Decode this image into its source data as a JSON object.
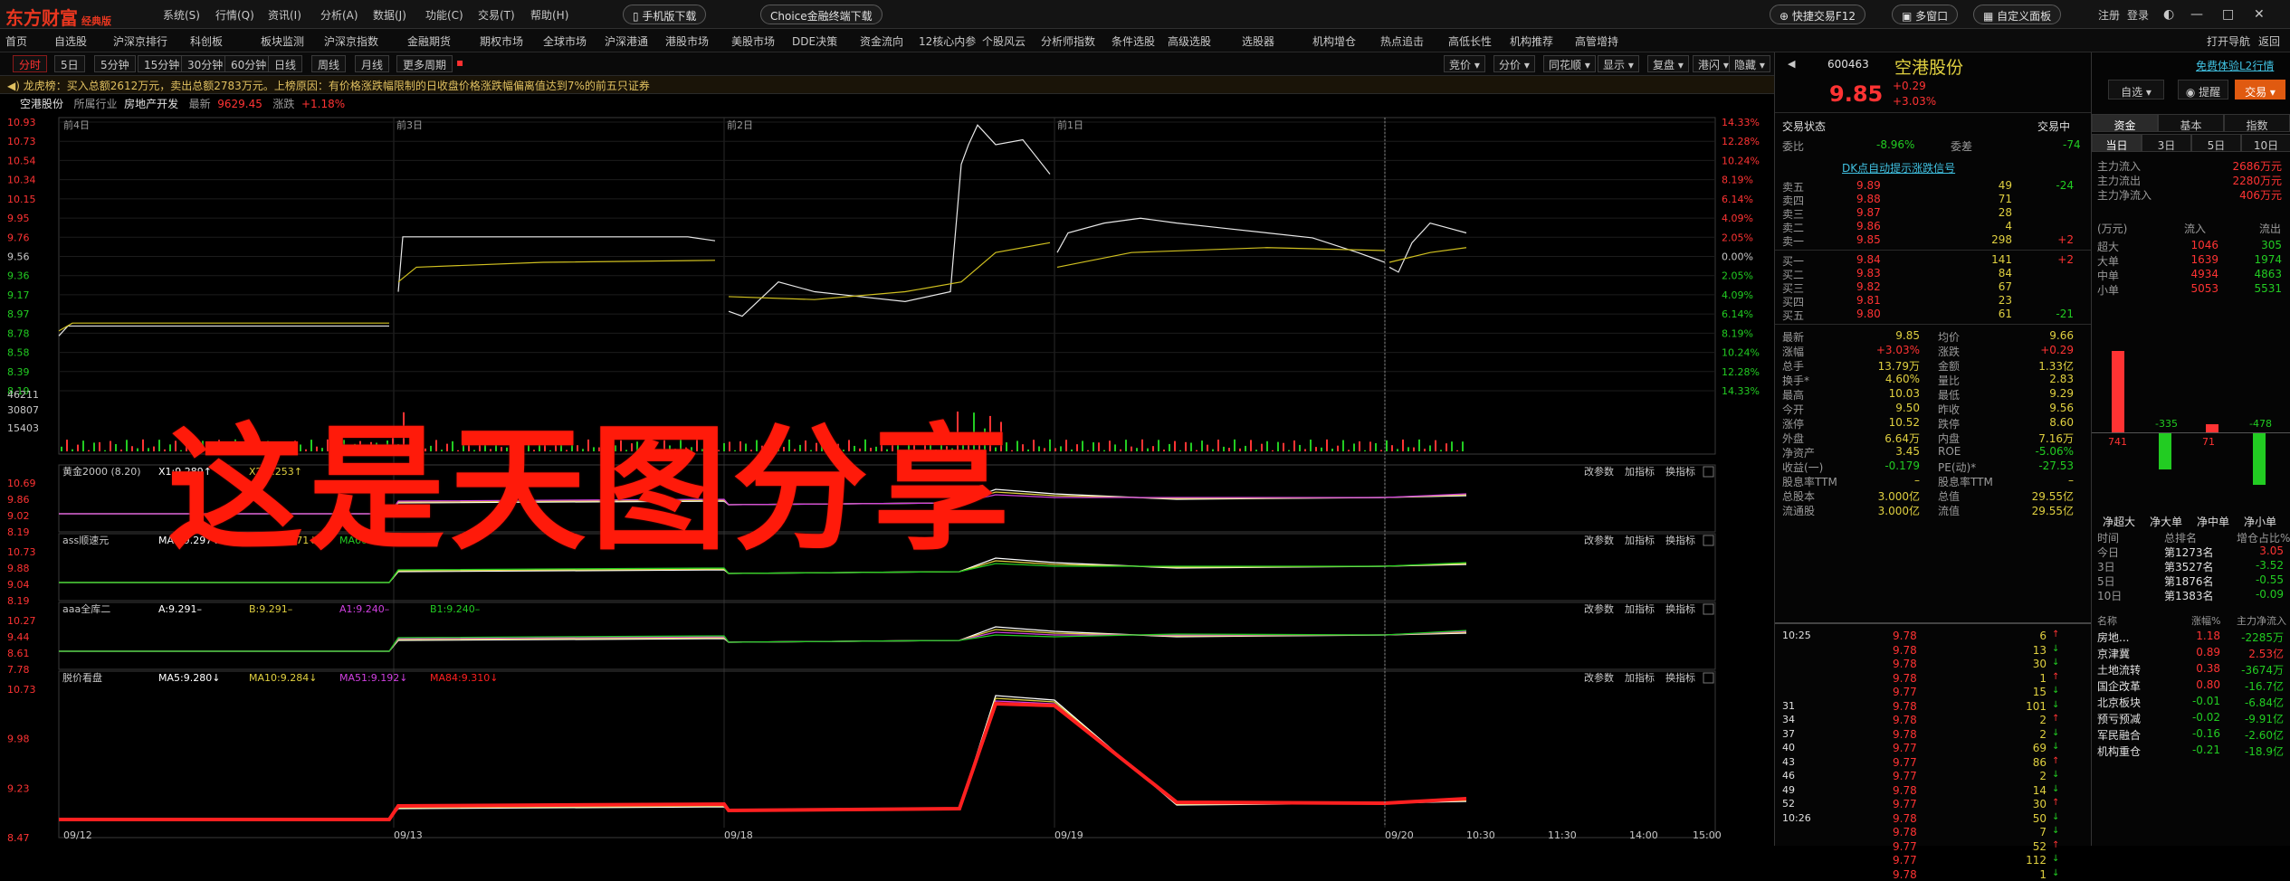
{
  "app": {
    "logo": "东方财富",
    "edition": "经典版"
  },
  "menu": [
    "系统(S)",
    "行情(Q)",
    "资讯(I)",
    "分析(A)",
    "数据(J)",
    "功能(C)",
    "交易(T)",
    "帮助(H)"
  ],
  "top_pills": {
    "mobile": "手机版下载",
    "choice": "Choice金融终端下载",
    "quick_trade": "快捷交易F12",
    "multi_window": "多窗口",
    "custom_board": "自定义面板"
  },
  "top_right": {
    "register": "注册",
    "login": "登录"
  },
  "nav": [
    "沪深京排行",
    "科创板",
    "板块监测",
    "沪深京指数",
    "金融期货",
    "期权市场",
    "全球市场",
    "沪深港通",
    "港股市场",
    "美股市场",
    "DDE决策",
    "资金流向",
    "12核心内参",
    "个股风云",
    "分析师指数",
    "条件选股",
    "高级选股",
    "选股器",
    "机构增仓",
    "热点追击",
    "高低长性",
    "机构推荐",
    "高管增持"
  ],
  "nav_left": {
    "home": "首页",
    "self_select": "自选股"
  },
  "nav_right": {
    "open_trade": "打开导航",
    "back": "返回"
  },
  "periods": [
    "分时",
    "5日",
    "5分钟",
    "15分钟",
    "30分钟",
    "60分钟",
    "日线",
    "周线",
    "月线",
    "更多周期"
  ],
  "period_active": 0,
  "chart_tools": [
    "竞价",
    "分价",
    "同花顺",
    "显示",
    "复盘",
    "港闪",
    "隐藏"
  ],
  "news": "龙虎榜：买入总额2612万元，卖出总额2783万元。上榜原因：有价格涨跌幅限制的日收盘价格涨跌幅偏离值达到7%的前五只证券",
  "stockline": {
    "name": "空港股份",
    "industry": "所属行业",
    "industry_val": "房地产开发",
    "latest": "最新",
    "latest_val": "9629.45",
    "change": "涨跌",
    "change_val": "+1.18%"
  },
  "price_axis_left": [
    "10.93",
    "10.73",
    "10.54",
    "10.34",
    "10.15",
    "9.95",
    "9.76",
    "9.56",
    "9.36",
    "9.17",
    "8.97",
    "8.78",
    "8.58",
    "8.39",
    "8.19"
  ],
  "price_axis_right": [
    "14.33%",
    "12.28%",
    "10.24%",
    "8.19%",
    "6.14%",
    "4.09%",
    "2.05%",
    "0.00%",
    "2.05%",
    "4.09%",
    "6.14%",
    "8.19%",
    "10.24%",
    "12.28%",
    "14.33%"
  ],
  "day_labels": [
    "前4日",
    "前3日",
    "前2日",
    "前1日"
  ],
  "vol_axis": [
    "46211",
    "30807",
    "15403"
  ],
  "x_dates": [
    "09/12",
    "09/13",
    "09/18",
    "09/19",
    "09/20",
    "10:30",
    "11:30",
    "14:00",
    "15:00"
  ],
  "overlay_text": "这是天图分享",
  "sub1": {
    "title": "黄金2000 (8.20)",
    "x1": "X1:9.289↑",
    "x2": "X2:9.253↑",
    "x3": "X3:9.232↑",
    "axis": [
      "10.69",
      "9.86",
      "9.02",
      "8.19"
    ]
  },
  "sub2": {
    "title": "ass顺速元",
    "ma5": "MA5:9.297↓",
    "ma20": "MA20:9.271↓",
    "ma60": "MA60:9.125↓",
    "axis": [
      "10.73",
      "9.88",
      "9.04",
      "8.19"
    ]
  },
  "sub3": {
    "title": "aaa全库二",
    "a": "A:9.291–",
    "b": "B:9.291–",
    "a1": "A1:9.240–",
    "b1": "B1:9.240–",
    "axis": [
      "10.27",
      "9.44",
      "8.61",
      "7.78"
    ]
  },
  "sub4": {
    "title": "脱价看盘",
    "ma5": "MA5:9.280↓",
    "ma10": "MA10:9.284↓",
    "ma51": "MA51:9.192↓",
    "ma84": "MA84:9.310↓",
    "axis": [
      "10.73",
      "9.98",
      "9.23",
      "8.47"
    ]
  },
  "sub_buttons": [
    "改参数",
    "加指标",
    "换指标"
  ],
  "quote": {
    "code": "600463",
    "name": "空港股份",
    "price": "9.85",
    "chg": "+0.29",
    "pct": "+3.03%",
    "promo": "免费体验L2行情",
    "self_select": "自选",
    "alert": "提醒",
    "trade": "交易",
    "status_label": "交易状态",
    "status_val": "交易中",
    "weibi_label": "委比",
    "weibi_val": "-8.96%",
    "weicha_label": "委差",
    "weicha_val": "-74",
    "dde_link": "DK点自动提示涨跌信号",
    "asks": [
      {
        "l": "卖五",
        "p": "9.89",
        "v": "49",
        "d": "-24"
      },
      {
        "l": "卖四",
        "p": "9.88",
        "v": "71",
        "d": ""
      },
      {
        "l": "卖三",
        "p": "9.87",
        "v": "28",
        "d": ""
      },
      {
        "l": "卖二",
        "p": "9.86",
        "v": "4",
        "d": ""
      },
      {
        "l": "卖一",
        "p": "9.85",
        "v": "298",
        "d": "+2"
      }
    ],
    "bids": [
      {
        "l": "买一",
        "p": "9.84",
        "v": "141",
        "d": "+2"
      },
      {
        "l": "买二",
        "p": "9.83",
        "v": "84",
        "d": ""
      },
      {
        "l": "买三",
        "p": "9.82",
        "v": "67",
        "d": ""
      },
      {
        "l": "买四",
        "p": "9.81",
        "v": "23",
        "d": ""
      },
      {
        "l": "买五",
        "p": "9.80",
        "v": "61",
        "d": "-21"
      }
    ],
    "stats": [
      [
        "最新",
        "9.85",
        "均价",
        "9.66"
      ],
      [
        "涨幅",
        "+3.03%",
        "涨跌",
        "+0.29"
      ],
      [
        "总手",
        "13.79万",
        "金额",
        "1.33亿"
      ],
      [
        "换手*",
        "4.60%",
        "量比",
        "2.83"
      ],
      [
        "最高",
        "10.03",
        "最低",
        "9.29"
      ],
      [
        "今开",
        "9.50",
        "昨收",
        "9.56"
      ],
      [
        "涨停",
        "10.52",
        "跌停",
        "8.60"
      ],
      [
        "外盘",
        "6.64万",
        "内盘",
        "7.16万"
      ],
      [
        "净资产",
        "3.45",
        "ROE",
        "-5.06%"
      ],
      [
        "收益(一)",
        "-0.179",
        "PE(动)*",
        "-27.53"
      ],
      [
        "股息率TTM",
        "–",
        "股息率TTM",
        "–"
      ],
      [
        "总股本",
        "3.000亿",
        "总值",
        "29.55亿"
      ],
      [
        "流通股",
        "3.000亿",
        "流值",
        "29.55亿"
      ]
    ],
    "ticks": [
      {
        "t": "10:25",
        "p": "9.78",
        "v": "6"
      },
      {
        "t": "",
        "p": "9.78",
        "v": "13"
      },
      {
        "t": "",
        "p": "9.78",
        "v": "30"
      },
      {
        "t": "",
        "p": "9.78",
        "v": "1"
      },
      {
        "t": "",
        "p": "9.77",
        "v": "15"
      },
      {
        "t": "31",
        "p": "9.78",
        "v": "101"
      },
      {
        "t": "34",
        "p": "9.78",
        "v": "2"
      },
      {
        "t": "37",
        "p": "9.78",
        "v": "2"
      },
      {
        "t": "40",
        "p": "9.77",
        "v": "69"
      },
      {
        "t": "43",
        "p": "9.77",
        "v": "86"
      },
      {
        "t": "46",
        "p": "9.77",
        "v": "2"
      },
      {
        "t": "49",
        "p": "9.78",
        "v": "14"
      },
      {
        "t": "52",
        "p": "9.77",
        "v": "30"
      },
      {
        "t": "10:26",
        "p": "9.78",
        "v": "50"
      },
      {
        "t": "",
        "p": "9.78",
        "v": "7"
      },
      {
        "t": "",
        "p": "9.77",
        "v": "52"
      },
      {
        "t": "",
        "p": "9.77",
        "v": "112"
      },
      {
        "t": "",
        "p": "9.78",
        "v": "1"
      }
    ]
  },
  "fund": {
    "tabs": [
      "资金",
      "基本",
      "指数"
    ],
    "subtabs": [
      "当日",
      "3日",
      "5日",
      "10日"
    ],
    "flows": [
      [
        "主力流入",
        "2686万元"
      ],
      [
        "主力流出",
        "2280万元"
      ],
      [
        "主力净流入",
        "406万元"
      ]
    ],
    "unit": "(万元)",
    "in": "流入",
    "out": "流出",
    "rows": [
      [
        "超大",
        "1046",
        "305"
      ],
      [
        "大单",
        "1639",
        "1974"
      ],
      [
        "中单",
        "4934",
        "4863"
      ],
      [
        "小单",
        "5053",
        "5531"
      ]
    ],
    "bar_vals": [
      "741",
      "-335",
      "71",
      "-478"
    ],
    "bar_labels": [
      "净超大",
      "净大单",
      "净中单",
      "净小单"
    ],
    "rank_hdr": [
      "时间",
      "总排名",
      "增仓占比%"
    ],
    "ranks": [
      [
        "今日",
        "第1273名",
        "3.05"
      ],
      [
        "3日",
        "第3527名",
        "-3.52"
      ],
      [
        "5日",
        "第1876名",
        "-0.55"
      ],
      [
        "10日",
        "第1383名",
        "-0.09"
      ]
    ],
    "sect_hdr": [
      "名称",
      "涨幅%",
      "主力净流入"
    ],
    "sectors": [
      [
        "房地...",
        "1.18",
        "-2285万"
      ],
      [
        "京津冀",
        "0.89",
        "2.53亿"
      ],
      [
        "土地流转",
        "0.38",
        "-3674万"
      ],
      [
        "国企改革",
        "0.80",
        "-16.7亿"
      ],
      [
        "北京板块",
        "-0.01",
        "-6.84亿"
      ],
      [
        "预亏预减",
        "-0.02",
        "-9.91亿"
      ],
      [
        "军民融合",
        "-0.16",
        "-2.60亿"
      ],
      [
        "机构重仓",
        "-0.21",
        "-18.9亿"
      ]
    ]
  }
}
